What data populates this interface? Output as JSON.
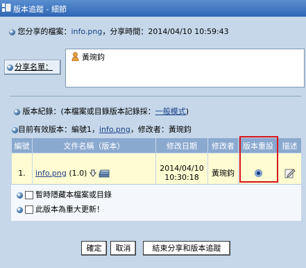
{
  "window": {
    "title": "版本追蹤 - 細節"
  },
  "info": {
    "prefix": "您分享的檔案：",
    "filename": "info.png",
    "time_label": "，分享時間：",
    "time_value": "2014/04/10 10:59:43"
  },
  "share": {
    "button_label": "分享名單：",
    "members": [
      "黃琬鈞"
    ]
  },
  "version_record": {
    "text": "版本紀錄：(本檔案或目錄版本記錄採：",
    "mode_link": "一般模式",
    "suffix": ")"
  },
  "current_version": {
    "prefix": "目前有效版本：編號1，",
    "filename": "info.png",
    "suffix": "，修改者：黃琬鈞"
  },
  "table": {
    "headers": [
      "編號",
      "文件名稱（版本）",
      "修改日期",
      "修改者",
      "版本重設",
      "描述"
    ],
    "rows": [
      {
        "num": "1.",
        "filename": "info.png",
        "version": "(1.0)",
        "date": "2014/04/10",
        "time": "10:30:18",
        "modifier": "黃琬鈞",
        "reset_selected": true
      }
    ]
  },
  "options": [
    {
      "label": "暫時隱藏本檔案或目錄",
      "checked": false
    },
    {
      "label": "此版本為重大更新！",
      "checked": false
    }
  ],
  "buttons": {
    "confirm": "確定",
    "cancel": "取消",
    "end_share": "結束分享和版本追蹤"
  },
  "colors": {
    "titlebar": "#2f66b5",
    "background": "#c5d7e9",
    "table_header": "#8aa9cf",
    "table_row": "#fffbd2",
    "highlight": "#d8141c",
    "link": "#1b3f8a"
  }
}
